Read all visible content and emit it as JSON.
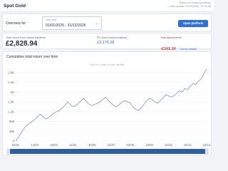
{
  "header": {
    "title": "Spot Gold",
    "note": "Based on closed positions",
    "updated": "Last update: 22/02/2026, 17:10:48"
  },
  "overview": {
    "label": "Overview for",
    "date_label": "Last year",
    "date_value": "01/01/2025 - 31/12/2025",
    "open_button": "Open platform"
  },
  "stats": {
    "total_label": "Total return from closed positions",
    "total_value": "£2,828.94",
    "pl_label": "P/L from closed positions",
    "pl_value": "£3,170.28",
    "adj_label": "Total adjustments",
    "adj_value": "-£341.34",
    "adj_link": "Check details"
  },
  "chart": {
    "title": "Cumulative total return over time",
    "hint": "Click on chart to see details"
  },
  "chart_data": {
    "type": "line",
    "title": "Cumulative total return over time",
    "x_ticks": [
      "02/01",
      "14/02",
      "28/03",
      "11/04",
      "30/05",
      "14/07",
      "03/08",
      "15/09",
      "04/10",
      "16/10",
      "23/12"
    ],
    "y_ticks": [
      "0",
      "400",
      "800",
      "1.2K",
      "1.6K",
      "2K",
      "2.4K",
      "2.8K"
    ],
    "ylim": [
      0,
      3000
    ],
    "series": [
      {
        "values": [
          0,
          150,
          350,
          500,
          650,
          720,
          800,
          880,
          1000,
          1100,
          1000,
          900,
          950,
          1050,
          1150,
          1200,
          1250,
          1350,
          1450,
          1600,
          1500,
          1400,
          1450,
          1550,
          1650,
          1750,
          1600,
          1500,
          1450,
          1500,
          1550,
          1600,
          1700,
          1800,
          1650,
          1550,
          1450,
          1400,
          1500,
          1600,
          1650,
          1600,
          1550,
          1400,
          1300,
          1250,
          1350,
          1500,
          1650,
          1750,
          1700,
          1600,
          1550,
          1650,
          1750,
          1900,
          1850,
          1800,
          1850,
          1950,
          2050,
          2000,
          2150,
          2100,
          2250,
          2350,
          2300,
          2450,
          2550,
          2750,
          2950
        ]
      }
    ],
    "grid": true,
    "color": "#8a93a3"
  },
  "colors": {
    "accent": "#2f6fd6",
    "negative": "#d23a3a",
    "scrollbar": "#2f5f9e"
  }
}
